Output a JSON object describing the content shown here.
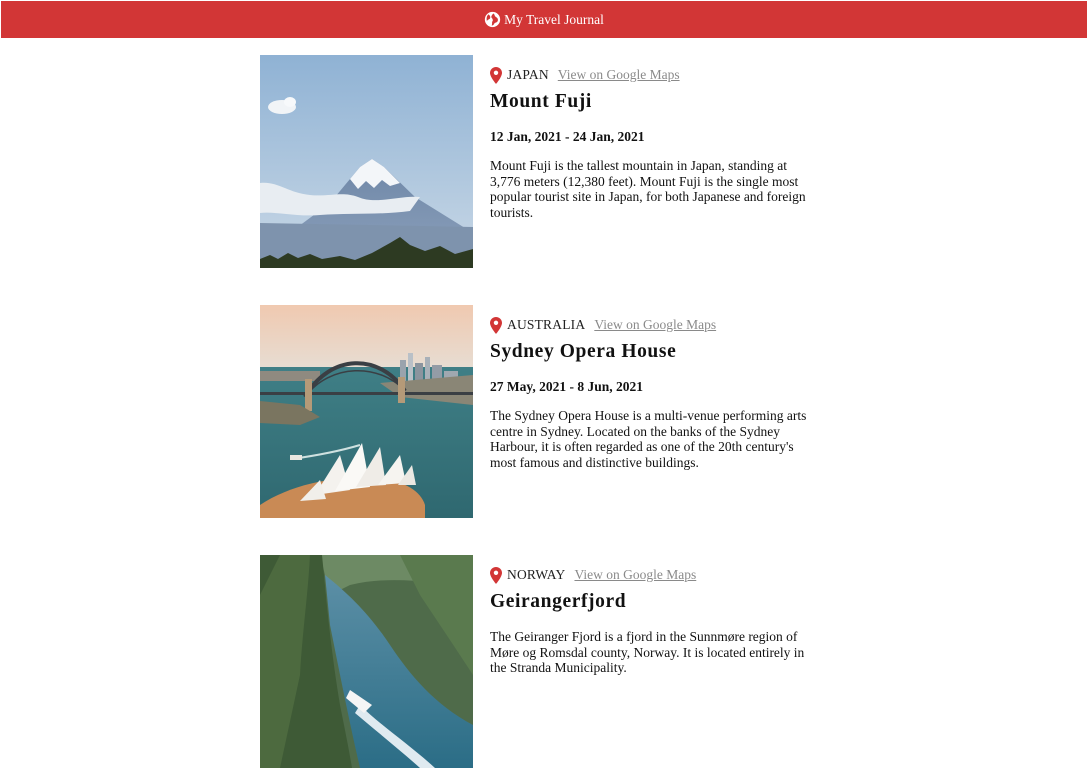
{
  "header": {
    "title": "My Travel Journal",
    "icon": "globe-icon"
  },
  "colors": {
    "brand": "#d23636",
    "pin": "#d23636",
    "link": "#8a8a8a"
  },
  "entries": [
    {
      "country": "JAPAN",
      "maps_link": "View on Google Maps",
      "title": "Mount Fuji",
      "dates": "12 Jan, 2021 - 24 Jan, 2021",
      "description": "Mount Fuji is the tallest mountain in Japan, standing at 3,776 meters (12,380 feet). Mount Fuji is the single most popular tourist site in Japan, for both Japanese and foreign tourists."
    },
    {
      "country": "AUSTRALIA",
      "maps_link": "View on Google Maps",
      "title": "Sydney Opera House",
      "dates": "27 May, 2021 - 8 Jun, 2021",
      "description": "The Sydney Opera House is a multi-venue performing arts centre in Sydney. Located on the banks of the Sydney Harbour, it is often regarded as one of the 20th century's most famous and distinctive buildings."
    },
    {
      "country": "NORWAY",
      "maps_link": "View on Google Maps",
      "title": "Geirangerfjord",
      "dates": "",
      "description": "The Geiranger Fjord is a fjord in the Sunnmøre region of Møre og Romsdal county, Norway. It is located entirely in the Stranda Municipality."
    }
  ]
}
